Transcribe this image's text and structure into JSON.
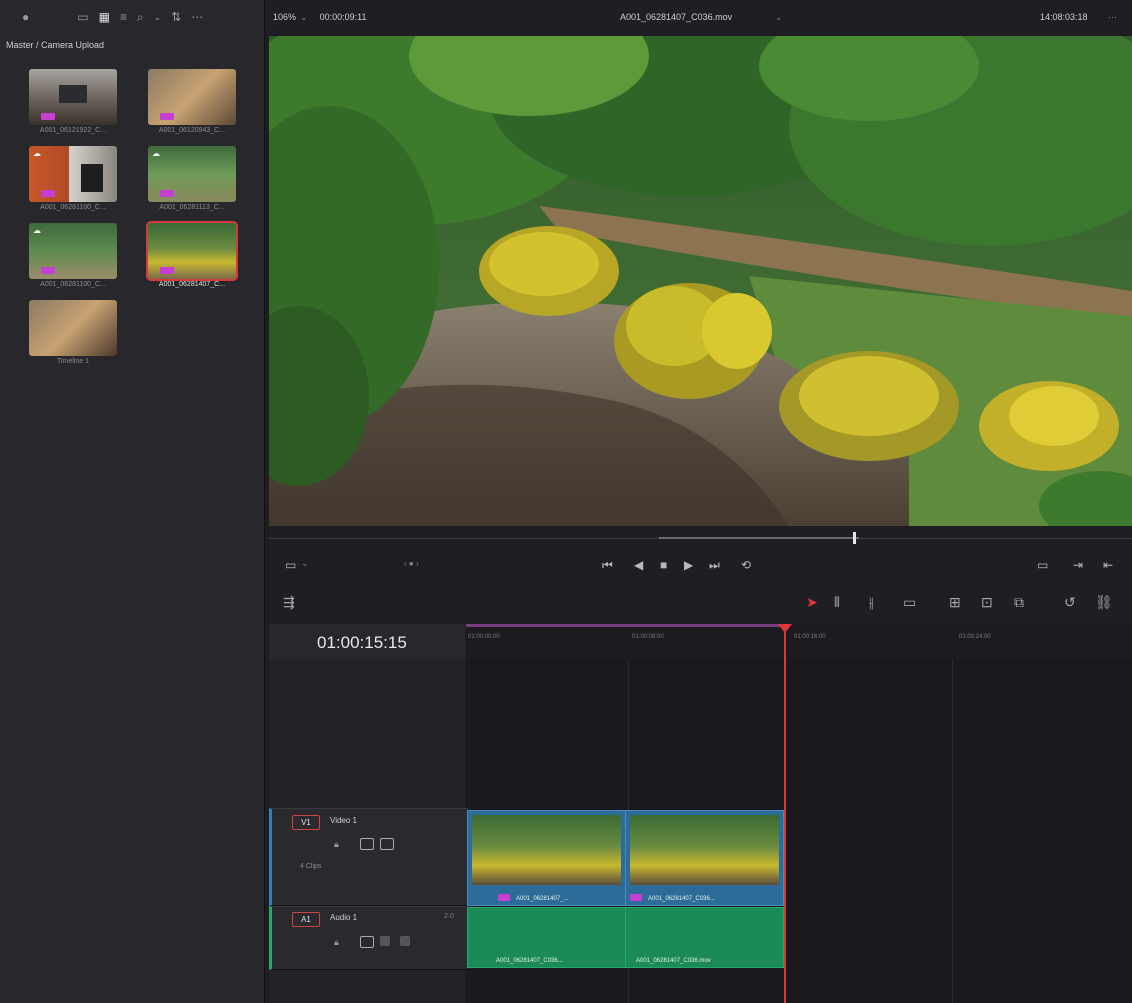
{
  "media_pool": {
    "bin_path": "Master / Camera Upload",
    "clips": [
      {
        "label": "A001_06121922_C...",
        "selected": false
      },
      {
        "label": "A001_06120943_C...",
        "selected": false
      },
      {
        "label": "A001_06281100_C...",
        "selected": false
      },
      {
        "label": "A001_06281113_C...",
        "selected": false
      },
      {
        "label": "A001_06281100_C...",
        "selected": false
      },
      {
        "label": "A001_06281407_C...",
        "selected": true
      },
      {
        "label": "Timeline 1",
        "selected": false
      }
    ]
  },
  "viewer": {
    "zoom": "106%",
    "source_timecode": "00:00:09:11",
    "clip_name": "A001_06281407_C036.mov",
    "record_timecode": "14:08:03:18"
  },
  "timeline": {
    "current_timecode": "01:00:15:15",
    "ruler_ticks": [
      "01:00:00:00",
      "01:00:08:00",
      "01:00:16:00",
      "01:00:24:00"
    ],
    "tracks": {
      "video": {
        "tag": "V1",
        "name": "Video 1",
        "clip_count": "4 Clips",
        "clips": [
          "A001_06281407_...",
          "A001_06281407_C036..."
        ]
      },
      "audio": {
        "tag": "A1",
        "name": "Audio 1",
        "channel": "2.0",
        "clips": [
          "A001_06281407_C036...",
          "A001_06281407_C036.mov"
        ]
      }
    }
  },
  "colors": {
    "accent_red": "#e23535",
    "video_clip": "#2d6c98",
    "audio_clip": "#1c8a58",
    "clip_badge": "#c43fd2"
  }
}
